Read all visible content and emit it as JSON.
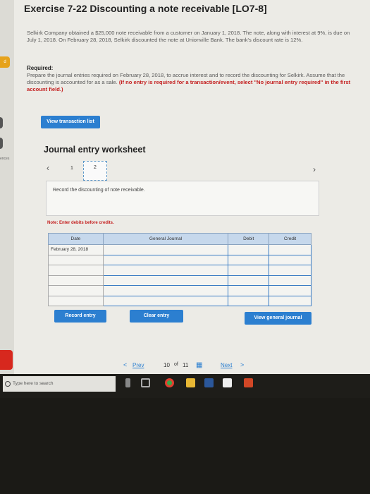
{
  "exercise": {
    "title": "Exercise 7-22 Discounting a note receivable [LO7-8]"
  },
  "problem": {
    "text": "Selkirk Company obtained a $25,000 note receivable from a customer on January 1, 2018. The note, along with interest at 9%, is due on July 1, 2018. On February 28, 2018, Selkirk discounted the note at Unionville Bank. The bank's discount rate is 12%."
  },
  "required": {
    "heading": "Required:",
    "instruction": "Prepare the journal entries required on February 28, 2018, to accrue interest and to record the discounting for Selkirk. Assume that the discounting is accounted for as a sale.",
    "note": "(If no entry is required for a transaction/event, select \"No journal entry required\" in the first account field.)"
  },
  "buttons": {
    "view_transaction_list": "View transaction list",
    "record_entry": "Record entry",
    "clear_entry": "Clear entry",
    "view_general_journal": "View general journal"
  },
  "worksheet": {
    "title": "Journal entry worksheet",
    "pages": [
      "1",
      "2"
    ],
    "description": "Record the discounting of note receivable.",
    "note": "Note: Enter debits before credits.",
    "columns": [
      "Date",
      "General Journal",
      "Debit",
      "Credit"
    ],
    "rows": [
      {
        "date": "February 28, 2018"
      },
      {
        "date": ""
      },
      {
        "date": ""
      },
      {
        "date": ""
      },
      {
        "date": ""
      },
      {
        "date": ""
      }
    ]
  },
  "pagination": {
    "prev": "Prev",
    "current": "10",
    "of": "of",
    "total": "11",
    "next": "Next"
  },
  "left_tabs": {
    "tab1": "ences"
  },
  "taskbar": {
    "search_placeholder": "Type here to search"
  },
  "colors": {
    "accent": "#2c7fd0",
    "note_red": "#c42020",
    "grid_blue": "#3b7cc4"
  }
}
